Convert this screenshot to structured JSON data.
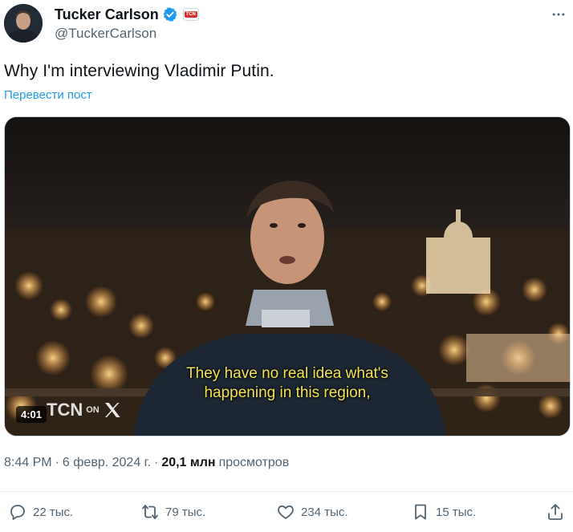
{
  "author": {
    "display_name": "Tucker Carlson",
    "handle": "@TuckerCarlson",
    "verified": true,
    "org_badge": "TCN"
  },
  "tweet": {
    "text": "Why I'm interviewing Vladimir Putin.",
    "translate_label": "Перевести пост"
  },
  "media": {
    "subtitle_line1": "They have no real idea what's",
    "subtitle_line2": "happening in this region,",
    "duration": "4:01",
    "watermark": "TCN",
    "watermark_suffix": "ON"
  },
  "meta": {
    "time": "8:44 PM",
    "separator": "·",
    "date": "6 февр. 2024 г.",
    "views_count": "20,1 млн",
    "views_label": "просмотров"
  },
  "actions": {
    "reply": "22 тыс.",
    "repost": "79 тыс.",
    "like": "234 тыс.",
    "bookmark": "15 тыс."
  },
  "colors": {
    "accent": "#1d9bf0",
    "text_primary": "#0f1419",
    "text_secondary": "#536471",
    "subtitle": "#f2e44a"
  }
}
